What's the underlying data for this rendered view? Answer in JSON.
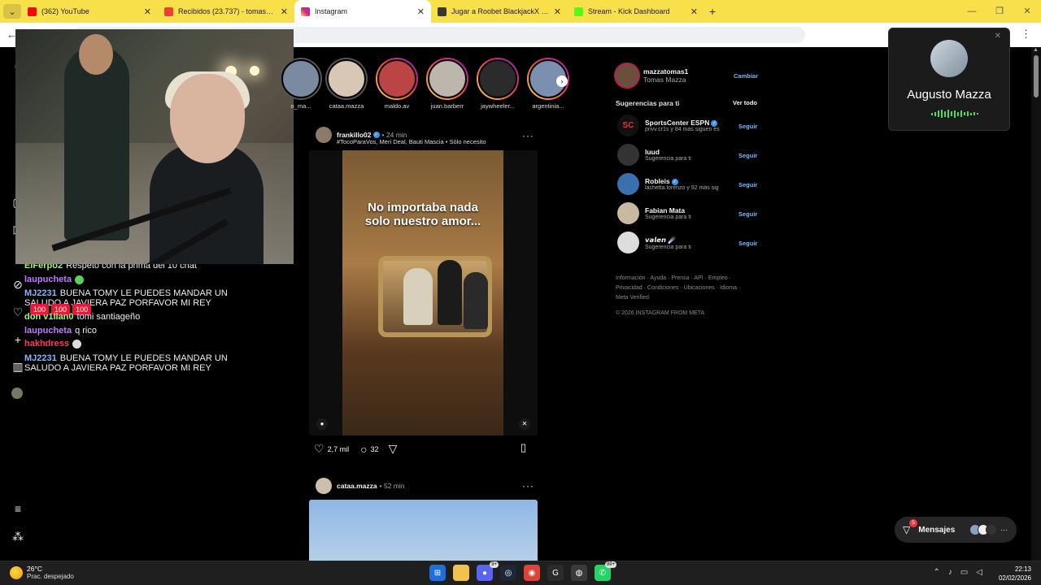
{
  "browser": {
    "tabs": [
      {
        "label": "(362) YouTube",
        "color": "#ff0000",
        "active": false
      },
      {
        "label": "Recibidos (23.737) - tomasmazza",
        "color": "#ea4335",
        "active": false
      },
      {
        "label": "Instagram",
        "color": "#d62976",
        "active": true
      },
      {
        "label": "Jugar a Roobet BlackjackX 2 - R",
        "color": "#2b2b2b",
        "active": false
      },
      {
        "label": "Stream - Kick Dashboard",
        "color": "#53fc18",
        "active": false
      }
    ],
    "new_tab": "+"
  },
  "chat": {
    "messages": [
      {
        "user": "ElFerpo2",
        "color": "#aef36b",
        "text": "Respeto con la prima del 10 chat"
      },
      {
        "user": "laupucheta",
        "color": "#c07bff",
        "text": ""
      },
      {
        "user": "MJ2231",
        "color": "#8ab4ff",
        "text": "BUENA TOMY LE PUEDES MANDAR UN",
        "text2": "SALUDO A JAVIERA PAZ PORFAVOR MI REY"
      },
      {
        "user": "don v1llan0",
        "color": "#aef36b",
        "text": "tomi santiageño"
      },
      {
        "user": "laupucheta",
        "color": "#c07bff",
        "text": "q rico"
      },
      {
        "user": "hakhdress",
        "color": "#ff3b5c",
        "text": ""
      },
      {
        "user": "MJ2231",
        "color": "#8ab4ff",
        "text": "BUENA TOMY LE PUEDES MANDAR UN",
        "text2": "SALUDO A JAVIERA PAZ PORFAVOR MI REY"
      }
    ],
    "stats": [
      "100",
      "100",
      "100"
    ]
  },
  "stories": [
    {
      "name": "o_ma..."
    },
    {
      "name": "cataa.mazza"
    },
    {
      "name": "maldo.av"
    },
    {
      "name": "juan.barberr"
    },
    {
      "name": "jaywheeler..."
    },
    {
      "name": "argentinia..."
    }
  ],
  "post1": {
    "user": "frankillo02",
    "time": "24 min",
    "sub": "#TocoParaVos, Meri Deal, Bauti Mascia • Sólo necesito",
    "caption_line1": "No importaba nada",
    "caption_line2": "solo nuestro amor...",
    "likes": "2,7 mil",
    "comments": "32"
  },
  "post2": {
    "user": "cataa.mazza",
    "time": "52 min"
  },
  "sidebar": {
    "me": {
      "username": "mazzatomas1",
      "fullname": "Tomas Mazza",
      "switch": "Cambiar"
    },
    "suggestions_title": "Sugerencias para ti",
    "see_all": "Ver todo",
    "follow_label": "Seguir",
    "suggestions": [
      {
        "name": "SportsCenter ESPN",
        "sub": "privv.cr1s y 84 más siguen es",
        "verified": true
      },
      {
        "name": "luud",
        "sub": "Sugerencia para ti",
        "verified": false
      },
      {
        "name": "Robleis",
        "sub": "lachetta.lorenzo y 92 más sig",
        "verified": true
      },
      {
        "name": "Fabian Mata",
        "sub": "Sugerencia para ti",
        "verified": false
      },
      {
        "name": "𝙫𝙖𝙡𝙚𝙣 ☄️",
        "sub": "Sugerencia para ti",
        "verified": false
      }
    ],
    "footer_line1": "Información · Ayuda · Prensa · API · Empleo ·",
    "footer_line2": "Privacidad · Condiciones · Ubicaciones · Idioma ·",
    "footer_line3": "Meta Verified",
    "copyright": "© 2026 INSTAGRAM FROM META"
  },
  "call": {
    "name": "Augusto Mazza"
  },
  "messages": {
    "label": "Mensajes",
    "badge": "5"
  },
  "taskbar": {
    "temp": "26°C",
    "weather": "Prac. despejado",
    "discord_badge": "9+",
    "whatsapp_badge": "99+",
    "time": "22:13",
    "date": "02/02/2026"
  }
}
